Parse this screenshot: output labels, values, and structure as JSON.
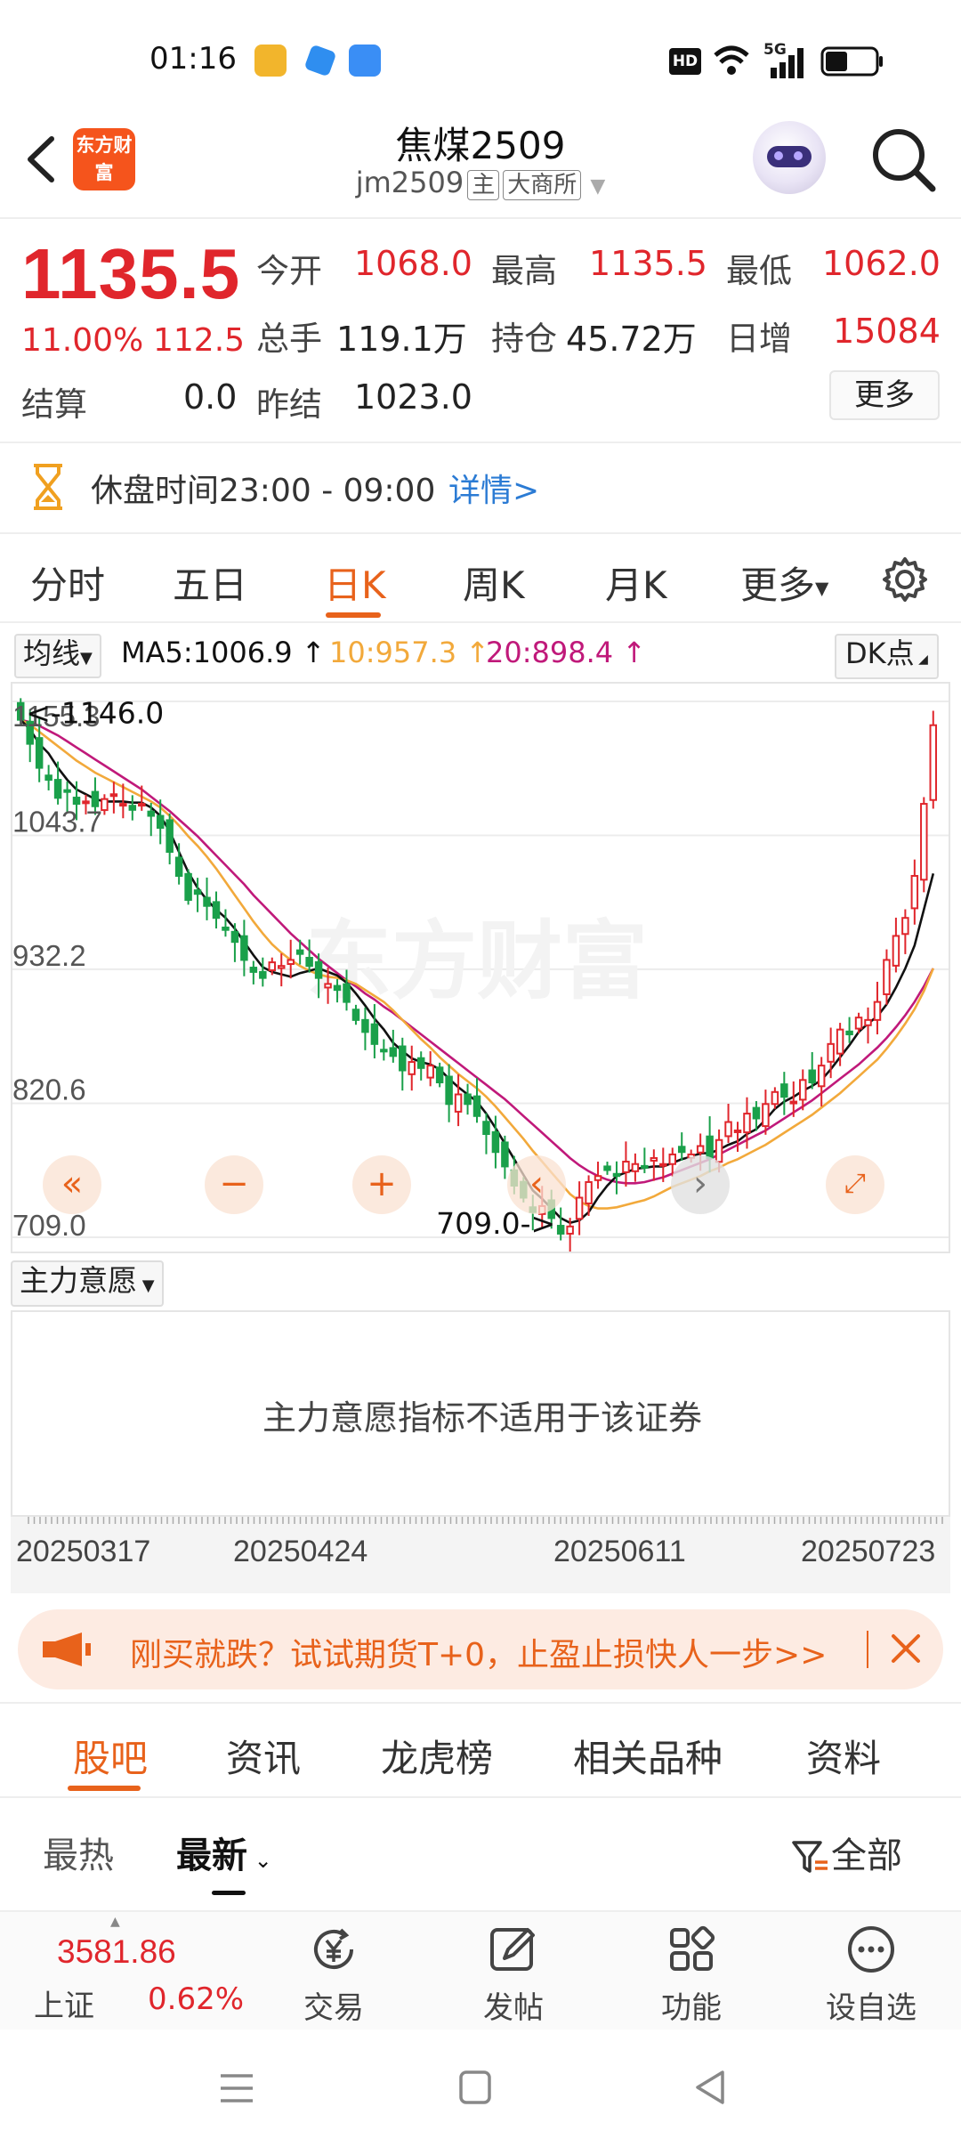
{
  "status_bar": {
    "time": "01:16",
    "hd_label": "HD",
    "network_label": "5G"
  },
  "header": {
    "logo_text": "东方财富",
    "title": "焦煤2509",
    "code": "jm2509",
    "tag_main": "主",
    "tag_exchange": "大商所"
  },
  "quote": {
    "price": "1135.5",
    "change_pct": "11.00%",
    "change": "112.5",
    "settle_label": "结算",
    "settle_value": "0.0",
    "open_label": "今开",
    "open_value": "1068.0",
    "high_label": "最高",
    "high_value": "1135.5",
    "low_label": "最低",
    "low_value": "1062.0",
    "volume_label": "总手",
    "volume_value": "119.1万",
    "oi_label": "持仓",
    "oi_value": "45.72万",
    "daily_inc_label": "日增",
    "daily_inc_value": "15084",
    "prev_settle_label": "昨结",
    "prev_settle_value": "1023.0",
    "more_label": "更多"
  },
  "notice": {
    "text": "休盘时间23:00 - 09:00",
    "link": "详情>"
  },
  "period_tabs": [
    "分时",
    "五日",
    "日K",
    "周K",
    "月K",
    "更多"
  ],
  "indicator": {
    "ma_select": "均线",
    "ma5": "MA5:1006.9",
    "ma10": "10:957.3",
    "ma20": "20:898.4",
    "dk_select": "DK点"
  },
  "chart_data": {
    "type": "candlestick",
    "y_ticks": [
      "1155.3",
      "1043.7",
      "932.2",
      "820.6",
      "709.0"
    ],
    "ylim": [
      709.0,
      1155.3
    ],
    "max_annotation": "<-1146.0",
    "min_annotation": "709.0->",
    "colors": {
      "up": "#e0262c",
      "down": "#1aa04a",
      "ma5": "#111111",
      "ma10": "#f2a93b",
      "ma20": "#c0197a"
    },
    "closes": [
      1140,
      1120,
      1100,
      1090,
      1075,
      1080,
      1070,
      1072,
      1068,
      1074,
      1078,
      1070,
      1065,
      1070,
      1060,
      1050,
      1030,
      1010,
      990,
      995,
      985,
      975,
      965,
      955,
      940,
      930,
      925,
      938,
      935,
      940,
      945,
      935,
      925,
      920,
      915,
      905,
      890,
      880,
      870,
      865,
      860,
      848,
      855,
      850,
      852,
      838,
      820,
      828,
      820,
      810,
      795,
      780,
      768,
      752,
      742,
      730,
      735,
      725,
      712,
      718,
      742,
      755,
      760,
      765,
      760,
      772,
      770,
      768,
      775,
      770,
      778,
      780,
      778,
      785,
      775,
      790,
      805,
      798,
      812,
      808,
      820,
      830,
      826,
      822,
      840,
      838,
      852,
      870,
      882,
      878,
      892,
      890,
      905,
      940,
      960,
      975,
      1010,
      1070,
      1135.5
    ],
    "ma5": [
      1140,
      1132,
      1120,
      1112,
      1100,
      1090,
      1082,
      1078,
      1074,
      1072,
      1072,
      1072,
      1071,
      1071,
      1067,
      1060,
      1047,
      1030,
      1013,
      1000,
      990,
      982,
      975,
      966,
      955,
      944,
      934,
      930,
      928,
      926,
      929,
      931,
      933,
      930,
      927,
      921,
      912,
      902,
      891,
      882,
      871,
      864,
      858,
      855,
      853,
      849,
      841,
      834,
      828,
      822,
      812,
      800,
      787,
      774,
      761,
      748,
      741,
      733,
      725,
      721,
      723,
      730,
      742,
      752,
      760,
      763,
      766,
      767,
      768,
      768,
      771,
      774,
      776,
      779,
      779,
      782,
      786,
      789,
      795,
      799,
      807,
      816,
      822,
      826,
      831,
      835,
      840,
      849,
      859,
      869,
      880,
      887,
      893,
      903,
      917,
      933,
      952,
      982,
      1012
    ],
    "ma10": [
      1140,
      1136,
      1130,
      1124,
      1118,
      1112,
      1106,
      1101,
      1096,
      1092,
      1088,
      1084,
      1080,
      1076,
      1072,
      1067,
      1060,
      1052,
      1043,
      1035,
      1026,
      1016,
      1005,
      994,
      983,
      972,
      962,
      953,
      946,
      940,
      935,
      931,
      928,
      926,
      925,
      923,
      920,
      915,
      910,
      905,
      898,
      890,
      882,
      874,
      867,
      859,
      852,
      845,
      839,
      833,
      826,
      818,
      809,
      800,
      791,
      781,
      772,
      763,
      754,
      745,
      739,
      735,
      733,
      733,
      734,
      736,
      738,
      740,
      743,
      747,
      751,
      754,
      757,
      760,
      764,
      767,
      771,
      774,
      778,
      782,
      786,
      791,
      796,
      801,
      806,
      811,
      817,
      823,
      829,
      836,
      843,
      850,
      857,
      866,
      876,
      887,
      899,
      914,
      933
    ],
    "ma20": [
      1140,
      1138,
      1135,
      1131,
      1127,
      1122,
      1117,
      1112,
      1107,
      1102,
      1097,
      1092,
      1087,
      1082,
      1076,
      1070,
      1064,
      1057,
      1050,
      1043,
      1035,
      1027,
      1019,
      1011,
      1003,
      994,
      986,
      978,
      970,
      962,
      955,
      948,
      941,
      935,
      929,
      923,
      918,
      912,
      907,
      901,
      896,
      890,
      884,
      878,
      872,
      866,
      860,
      854,
      848,
      842,
      836,
      830,
      824,
      817,
      810,
      803,
      796,
      789,
      782,
      775,
      769,
      764,
      760,
      757,
      755,
      754,
      754,
      755,
      757,
      759,
      762,
      765,
      768,
      771,
      774,
      778,
      782,
      786,
      790,
      794,
      798,
      803,
      808,
      813,
      818,
      823,
      829,
      835,
      841,
      847,
      853,
      860,
      867,
      875,
      884,
      894,
      905,
      918,
      933
    ]
  },
  "chart_controls": {
    "first_icon": "double-chevron-left-icon",
    "zoom_out_icon": "minus-icon",
    "zoom_in_icon": "plus-icon",
    "prev_icon": "chevron-left-icon",
    "next_icon": "chevron-right-icon",
    "fullscreen_icon": "expand-icon"
  },
  "main_force": {
    "select": "主力意愿",
    "message": "主力意愿指标不适用于该证券"
  },
  "date_axis": [
    "20250317",
    "20250424",
    "20250611",
    "20250723"
  ],
  "banner": {
    "text": "刚买就跌？试试期货T+0，止盈止损快人一步>>"
  },
  "section_tabs": [
    "股吧",
    "资讯",
    "龙虎榜",
    "相关品种",
    "资料"
  ],
  "sort": {
    "hot": "最热",
    "latest": "最新",
    "filter": "全部"
  },
  "footer": {
    "index_value": "3581.86",
    "index_name": "上证",
    "index_change": "0.62%",
    "trade": "交易",
    "post": "发帖",
    "functions": "功能",
    "add_watch": "设自选"
  }
}
